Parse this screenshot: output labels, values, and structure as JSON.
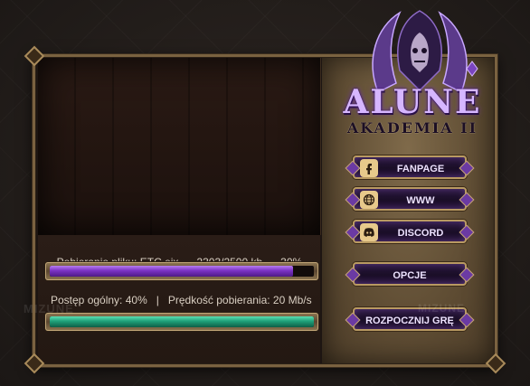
{
  "brand": {
    "title": "ALUNE",
    "subtitle": "AKADEMIA II"
  },
  "download": {
    "file_label": "Pobieranie pliku: ETC.eix",
    "file_size": "2303/2500 kb",
    "file_percent": "30%",
    "file_progress": 0.92,
    "overall_label": "Postęp ogólny: 40%   |   Prędkość pobierania: 20 Mb/s",
    "overall_progress": 1.0
  },
  "buttons": {
    "fanpage": "FANPAGE",
    "www": "WWW",
    "discord": "DISCORD",
    "options": "OPCJE",
    "start": "ROZPOCZNIJ GRĘ"
  },
  "watermarks": [
    "MIZUNE",
    "MIZUNE"
  ],
  "colors": {
    "accent_purple": "#8b3fd6",
    "accent_green": "#1f9f78",
    "frame_gold": "#b99a62"
  }
}
